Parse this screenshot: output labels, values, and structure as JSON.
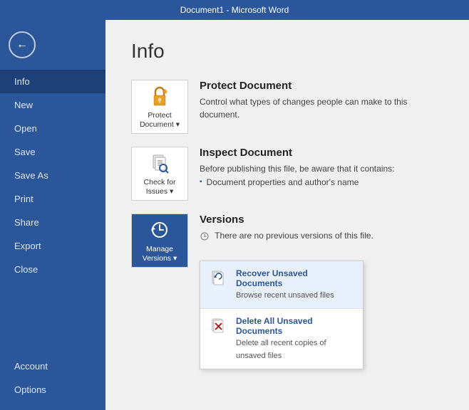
{
  "titlebar": {
    "text": "Document1 - Microsoft Word"
  },
  "sidebar": {
    "back_label": "←",
    "items": [
      {
        "id": "info",
        "label": "Info",
        "active": true
      },
      {
        "id": "new",
        "label": "New"
      },
      {
        "id": "open",
        "label": "Open"
      },
      {
        "id": "save",
        "label": "Save"
      },
      {
        "id": "saveas",
        "label": "Save As"
      },
      {
        "id": "print",
        "label": "Print"
      },
      {
        "id": "share",
        "label": "Share"
      },
      {
        "id": "export",
        "label": "Export"
      },
      {
        "id": "close",
        "label": "Close"
      }
    ],
    "bottom_items": [
      {
        "id": "account",
        "label": "Account"
      },
      {
        "id": "options",
        "label": "Options"
      }
    ]
  },
  "main": {
    "title": "Info",
    "sections": [
      {
        "id": "protect",
        "icon_label": "Protect\nDocument ▾",
        "heading": "Protect Document",
        "description": "Control what types of changes people can make to this document."
      },
      {
        "id": "inspect",
        "icon_label": "Check for\nIssues ▾",
        "heading": "Inspect Document",
        "description": "Before publishing this file, be aware that it contains:",
        "bullets": [
          "Document properties and author's name"
        ]
      },
      {
        "id": "versions",
        "icon_label": "Manage\nVersions ▾",
        "heading": "Versions",
        "description": "There are no previous versions of this file.",
        "active": true
      }
    ],
    "dropdown": {
      "items": [
        {
          "id": "recover",
          "label": "Recover Unsaved Documents",
          "sublabel": "Browse recent unsaved files",
          "hovered": true
        },
        {
          "id": "delete",
          "label": "Delete All Unsaved Documents",
          "sublabel": "Delete all recent copies of unsaved files",
          "hovered": false
        }
      ]
    }
  }
}
